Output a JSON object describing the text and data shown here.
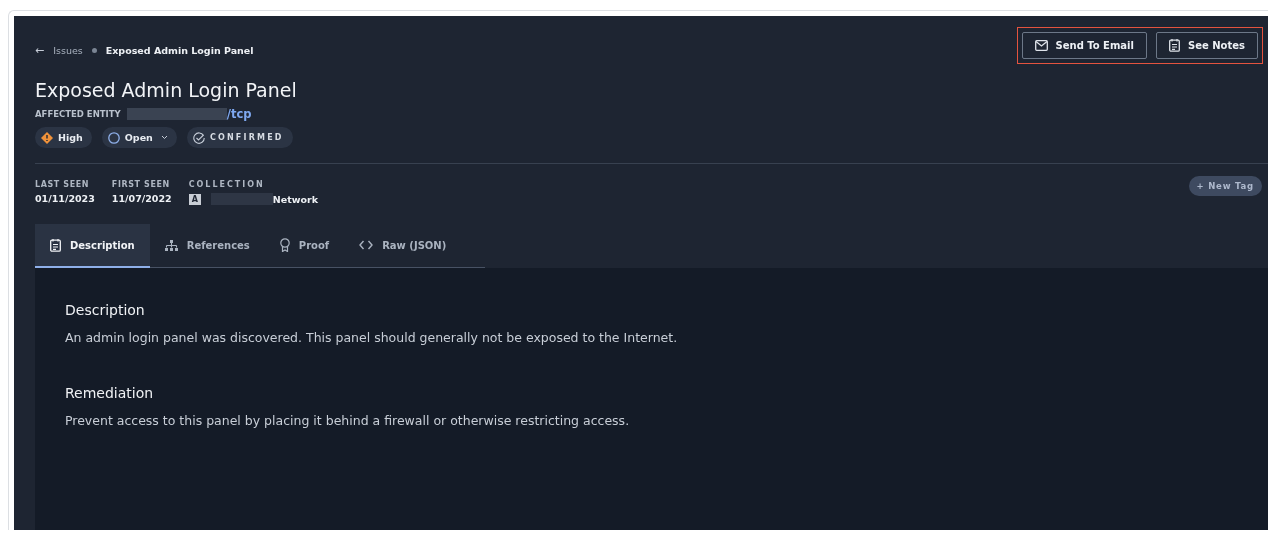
{
  "breadcrumb": {
    "back": "←",
    "parent": "Issues",
    "current": "Exposed Admin Login Panel"
  },
  "actions": [
    {
      "kind": "email",
      "label": "Send To Email"
    },
    {
      "kind": "notes",
      "label": "See Notes"
    }
  ],
  "highlighted_actions": true,
  "title": "Exposed Admin Login Panel",
  "affected_entity": {
    "label": "AFFECTED ENTITY",
    "value": "/tcp",
    "redacted": true
  },
  "badges": [
    {
      "kind": "severity",
      "label": "High",
      "color": "#f0923a"
    },
    {
      "kind": "status",
      "label": "Open",
      "dropdown": true
    },
    {
      "kind": "confirmed",
      "label": "CONFIRMED"
    }
  ],
  "meta": [
    {
      "label": "LAST SEEN",
      "value": "01/11/2023"
    },
    {
      "label": "FIRST SEEN",
      "value": "11/07/2022"
    },
    {
      "label": "COLLECTION",
      "value": "Network",
      "tag": "A",
      "redacted": true
    }
  ],
  "new_tag": "+ New Tag",
  "tabs": [
    {
      "kind": "description",
      "label": "Description",
      "selected": true
    },
    {
      "kind": "references",
      "label": "References",
      "selected": false
    },
    {
      "kind": "proof",
      "label": "Proof",
      "selected": false
    },
    {
      "kind": "raw",
      "label": "Raw (JSON)",
      "selected": false
    }
  ],
  "sections": [
    {
      "heading": "Description",
      "text": "An admin login panel was discovered. This panel should generally not be exposed to the Internet."
    },
    {
      "heading": "Remediation",
      "text": "Prevent access to this panel by placing it behind a firewall or otherwise restricting access."
    }
  ]
}
